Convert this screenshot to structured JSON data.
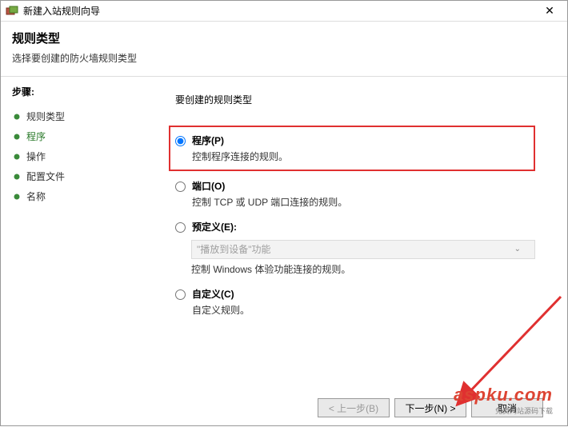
{
  "window": {
    "title": "新建入站规则向导"
  },
  "header": {
    "title": "规则类型",
    "subtitle": "选择要创建的防火墙规则类型"
  },
  "sidebar": {
    "label": "步骤:",
    "steps": [
      {
        "label": "规则类型",
        "state": "done"
      },
      {
        "label": "程序",
        "state": "current"
      },
      {
        "label": "操作",
        "state": "done"
      },
      {
        "label": "配置文件",
        "state": "done"
      },
      {
        "label": "名称",
        "state": "done"
      }
    ]
  },
  "content": {
    "question": "要创建的规则类型",
    "options": [
      {
        "key": "program",
        "label": "程序(P)",
        "desc": "控制程序连接的规则。",
        "checked": true,
        "highlighted": true
      },
      {
        "key": "port",
        "label": "端口(O)",
        "desc": "控制 TCP 或 UDP 端口连接的规则。",
        "checked": false
      },
      {
        "key": "predefined",
        "label": "预定义(E):",
        "desc": "控制 Windows 体验功能连接的规则。",
        "checked": false,
        "select_value": "\"播放到设备\"功能",
        "disabled_select": true
      },
      {
        "key": "custom",
        "label": "自定义(C)",
        "desc": "自定义规则。",
        "checked": false
      }
    ]
  },
  "footer": {
    "back": "< 上一步(B)",
    "next": "下一步(N) >",
    "cancel": "取消"
  },
  "watermark": {
    "main": "aspku.com",
    "sub": "免费网站源码下载"
  }
}
